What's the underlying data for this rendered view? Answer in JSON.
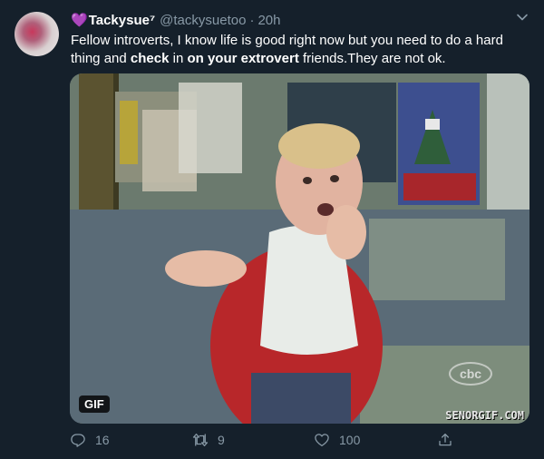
{
  "author": {
    "emoji": "💜",
    "display_name": "Tackysue",
    "superscript": "⁷",
    "handle": "@tackysuetoo",
    "separator": "·",
    "timestamp": "20h"
  },
  "tweet": {
    "text_part1": "Fellow introverts, I know life is good right now but you need to do a hard thing and ",
    "text_bold1": "check",
    "text_part2": " in ",
    "text_bold2": "on your extrovert",
    "text_part3": " friends.They are not ok."
  },
  "media": {
    "badge": "GIF",
    "watermark": "SENORGIF.COM",
    "network_logo": "cbc"
  },
  "actions": {
    "reply_count": "16",
    "retweet_count": "9",
    "like_count": "100"
  },
  "icons": [
    "heart-emoji-icon",
    "chevron-down-icon",
    "reply-icon",
    "retweet-icon",
    "like-icon",
    "share-icon"
  ],
  "colors": {
    "background": "#15202b",
    "secondary_text": "#8899a6",
    "primary_text": "#ffffff",
    "purple_heart": "#b37feb"
  }
}
